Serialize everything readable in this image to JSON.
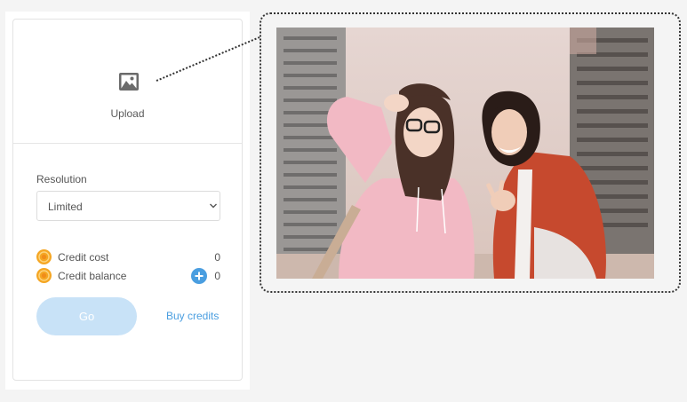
{
  "upload": {
    "label": "Upload",
    "icon": "image-icon"
  },
  "resolution": {
    "label": "Resolution",
    "selected": "Limited"
  },
  "credits": {
    "cost_label": "Credit cost",
    "cost_value": "0",
    "balance_label": "Credit balance",
    "balance_value": "0",
    "coin_icon": "coin-icon",
    "add_icon": "plus-circle-icon"
  },
  "actions": {
    "go_label": "Go",
    "buy_label": "Buy credits"
  },
  "colors": {
    "accent": "#4a9ee0",
    "go_disabled": "#c8e2f7",
    "coin": "#f5a623"
  }
}
